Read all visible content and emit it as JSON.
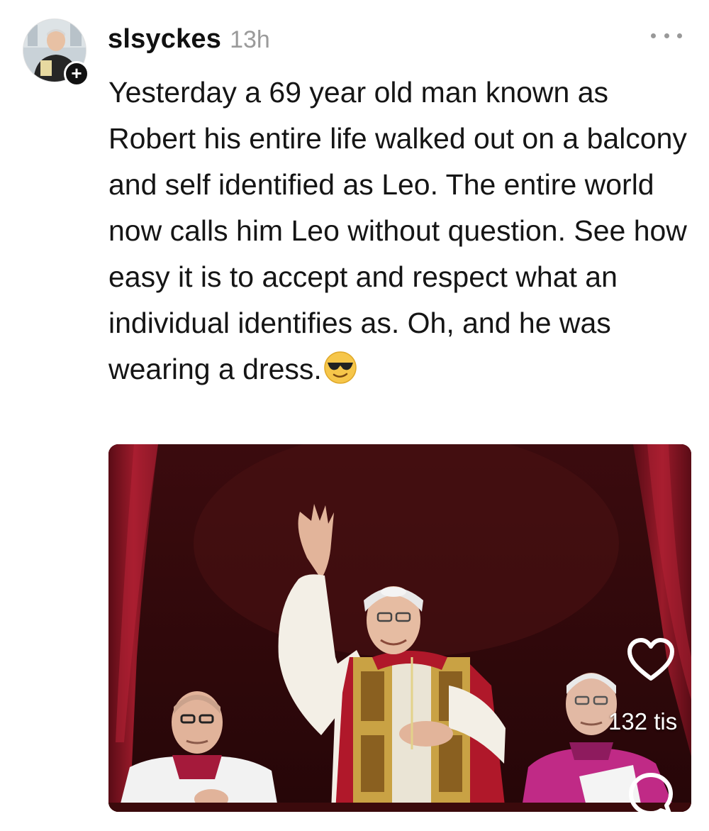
{
  "post": {
    "author": {
      "username": "slsyckes",
      "follow_label": "+"
    },
    "timestamp": "13h",
    "caption": "Yesterday a 69 year old man known as Robert his entire life walked out on a balcony and self identified as Leo. The entire world now calls him Leo without question. See how easy it is to accept and respect what an individual identifies as. Oh, and he was wearing a dress.",
    "emoji": "smiling-face-with-sunglasses",
    "media": {
      "type": "photo",
      "icons": [
        "heart-icon",
        "comment-icon"
      ]
    },
    "like_count": "132 tis"
  },
  "colors": {
    "background": "#ffffff",
    "text": "#111111",
    "muted": "#9a9a9a",
    "curtain": "#7a1420",
    "robe_red": "#b0182a",
    "vestment_gold": "#c9a244"
  }
}
